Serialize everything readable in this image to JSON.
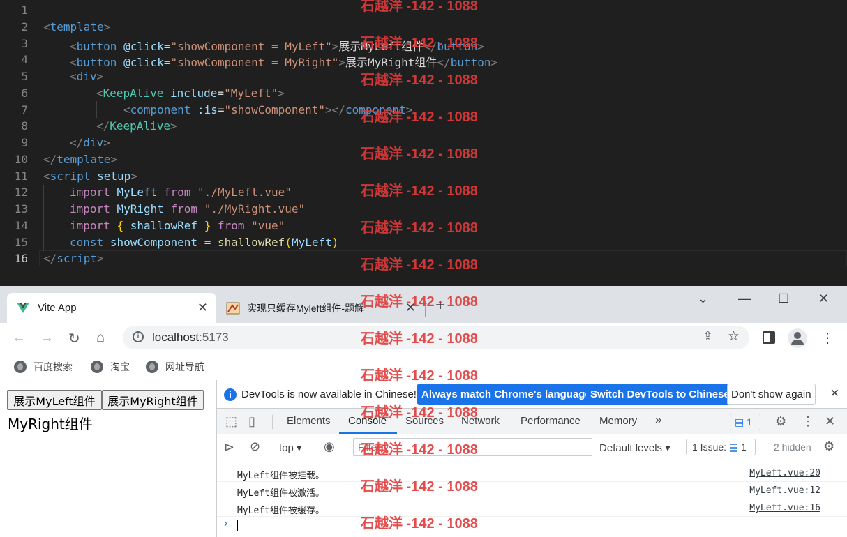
{
  "editor": {
    "line_numbers": [
      "1",
      "2",
      "3",
      "4",
      "5",
      "6",
      "7",
      "8",
      "9",
      "10",
      "11",
      "12",
      "13",
      "14",
      "15",
      "16"
    ],
    "lines": {
      "l2": {
        "open": "<",
        "tag": "template",
        "close": ">"
      },
      "l3": {
        "open": "<",
        "tag": "button",
        "sp": " ",
        "attr": "@click",
        "eq": "=",
        "str": "\"showComponent = MyLeft\"",
        "close": ">",
        "text": "展示MyLeft组件",
        "open2": "</",
        "tag2": "button",
        "close2": ">"
      },
      "l4": {
        "open": "<",
        "tag": "button",
        "sp": " ",
        "attr": "@click",
        "eq": "=",
        "str": "\"showComponent = MyRight\"",
        "close": ">",
        "text": "展示MyRight组件",
        "open2": "</",
        "tag2": "button",
        "close2": ">"
      },
      "l5": {
        "open": "<",
        "tag": "div",
        "close": ">"
      },
      "l6": {
        "open": "<",
        "tag": "KeepAlive",
        "sp": " ",
        "attr": "include",
        "eq": "=",
        "str": "\"MyLeft\"",
        "close": ">"
      },
      "l7": {
        "open": "<",
        "tag": "component",
        "sp": " ",
        "attr": ":is",
        "eq": "=",
        "str": "\"showComponent\"",
        "close": ">",
        "open2": "</",
        "tag2": "component",
        "close2": ">"
      },
      "l8": {
        "open": "</",
        "tag": "KeepAlive",
        "close": ">"
      },
      "l9": {
        "open": "</",
        "tag": "div",
        "close": ">"
      },
      "l10": {
        "open": "</",
        "tag": "template",
        "close": ">"
      },
      "l11": {
        "open": "<",
        "tag": "script",
        "sp": " ",
        "attr": "setup",
        "close": ">"
      },
      "l12": {
        "kw": "import",
        "var": "MyLeft",
        "kw2": "from",
        "str": "\"./MyLeft.vue\""
      },
      "l13": {
        "kw": "import",
        "var": "MyRight",
        "kw2": "from",
        "str": "\"./MyRight.vue\""
      },
      "l14": {
        "kw": "import",
        "b1": "{",
        "var": "shallowRef",
        "b2": "}",
        "kw2": "from",
        "str": "\"vue\""
      },
      "l15": {
        "kw": "const",
        "var": "showComponent",
        "eq": "=",
        "fn": "shallowRef",
        "p1": "(",
        "arg": "MyLeft",
        "p2": ")"
      },
      "l16": {
        "open": "</",
        "tag": "script",
        "close": ">"
      }
    }
  },
  "browser": {
    "tabs": [
      {
        "title": "Vite App",
        "close": "✕"
      },
      {
        "title": "实现只缓存Myleft组件-题解",
        "close": "✕"
      }
    ],
    "new_tab": "+",
    "window": {
      "minimize": "—",
      "restore": "☐",
      "close": "✕",
      "dropdown": "⌄"
    },
    "url_host": "localhost",
    "url_port": ":5173",
    "bookmarks": [
      "百度搜索",
      "淘宝",
      "网址导航"
    ]
  },
  "page": {
    "button_left": "展示MyLeft组件",
    "button_right": "展示MyRight组件",
    "text": "MyRight组件"
  },
  "devtools": {
    "info_text": "DevTools is now available in Chinese!",
    "btn_match": "Always match Chrome's language",
    "btn_switch": "Switch DevTools to Chinese",
    "btn_dont": "Don't show again",
    "tabs": [
      "Elements",
      "Console",
      "Sources",
      "Network",
      "Performance",
      "Memory"
    ],
    "more": "»",
    "msg_count": "1",
    "context": "top",
    "filter_placeholder": "Filter",
    "levels": "Default levels",
    "issues": "1 Issue:",
    "issues_count": "1",
    "hidden": "2 hidden",
    "logs": [
      {
        "msg": "MyLeft组件被挂载。",
        "src": "MyLeft.vue:20"
      },
      {
        "msg": "MyLeft组件被激活。",
        "src": "MyLeft.vue:12"
      },
      {
        "msg": "MyLeft组件被缓存。",
        "src": "MyLeft.vue:16"
      }
    ],
    "prompt": "›"
  },
  "watermark": "石越洋 -142 - 1088",
  "colors": {
    "editor_bg": "#1f1f1f",
    "accent": "#1a73e8",
    "watermark": "#e03a3a"
  }
}
